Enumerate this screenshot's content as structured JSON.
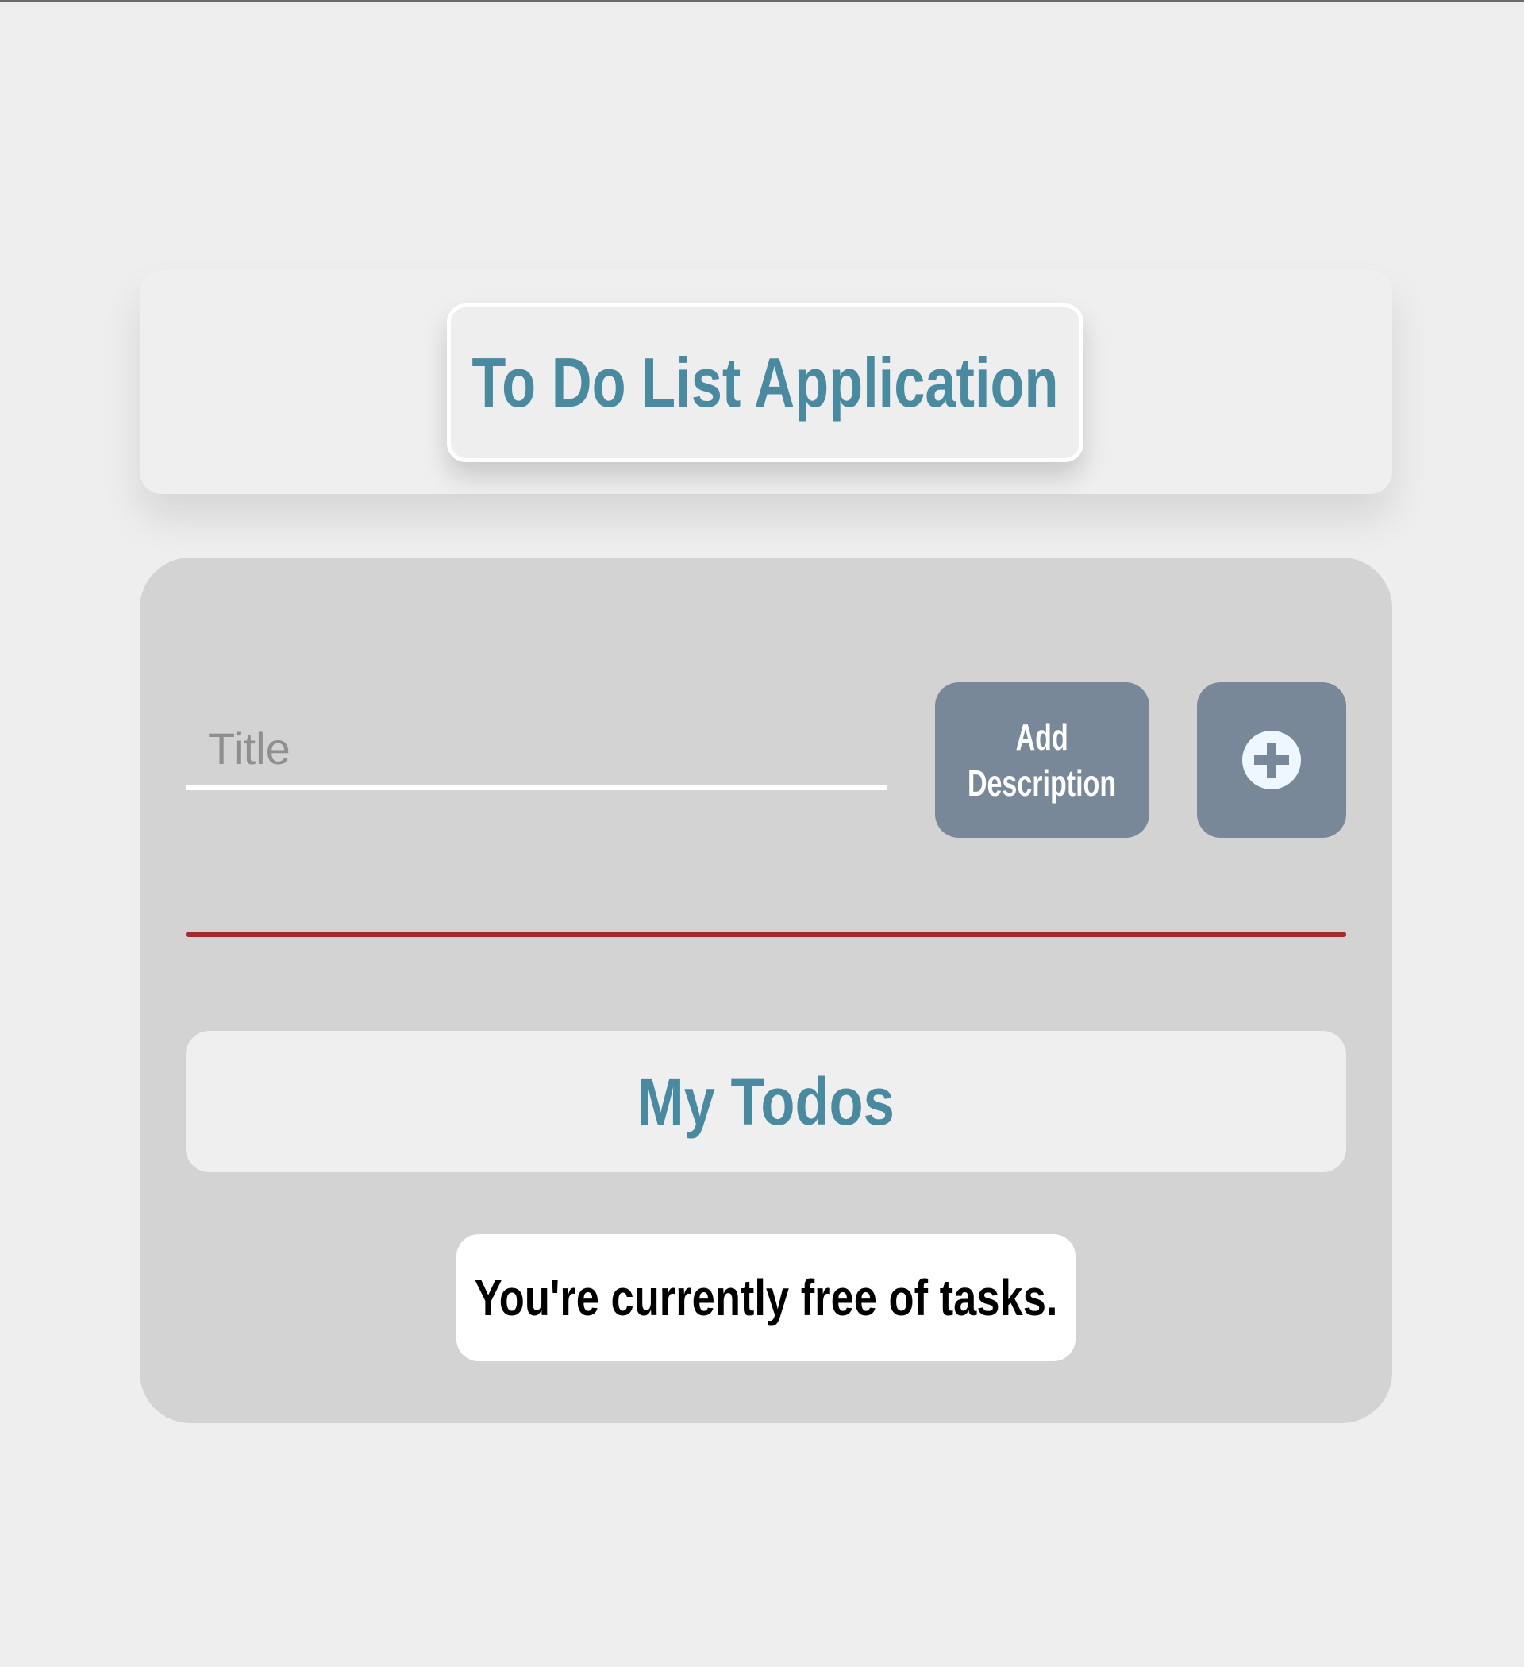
{
  "header": {
    "title": "To Do List Application"
  },
  "form": {
    "title_placeholder": "Title",
    "title_value": "",
    "add_description_label_line1": "Add",
    "add_description_label_line2": "Description",
    "add_icon": "plus-circle-icon"
  },
  "todos": {
    "heading": "My Todos",
    "empty_message": "You're currently free of tasks.",
    "items": []
  },
  "colors": {
    "background": "#eeeeee",
    "accent_text": "#4a8aa0",
    "button": "#788899",
    "divider": "#a52a2a",
    "panel": "#d3d3d3"
  }
}
